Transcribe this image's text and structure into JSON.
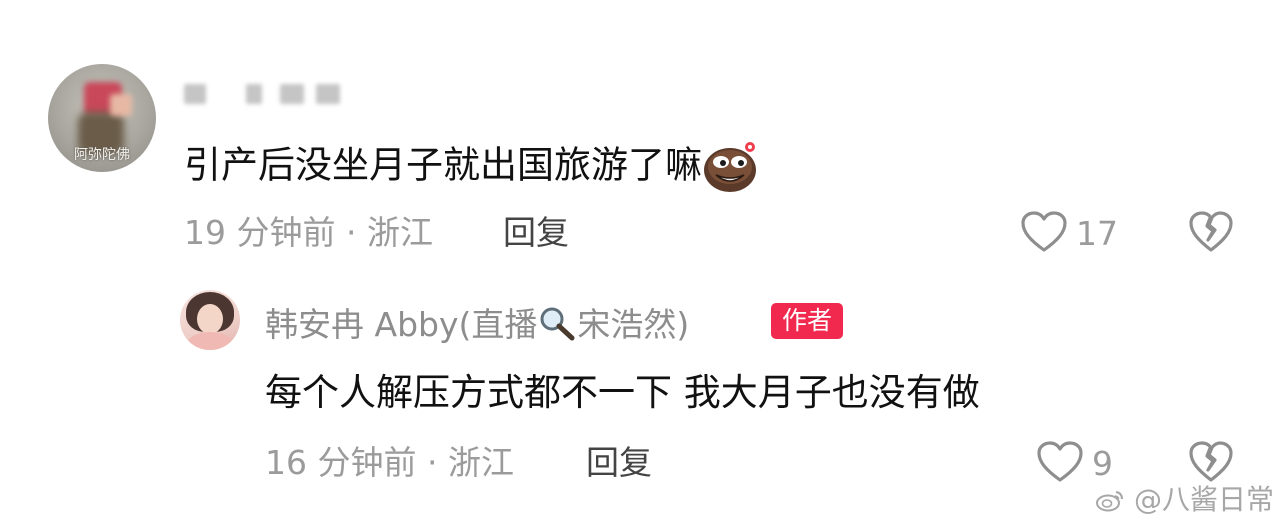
{
  "comment": {
    "avatar_caption": "阿弥陀佛",
    "text": "引产后没坐月子就出国旅游了嘛",
    "emoji": "sly-face-emoji",
    "time": "19 分钟前",
    "location": "浙江",
    "separator": "·",
    "reply_label": "回复",
    "like_count": "17"
  },
  "reply": {
    "author_name": "韩安冉 Abby(直播",
    "author_name_suffix": "宋浩然)",
    "search_icon": "magnifier-icon",
    "badge": "作者",
    "text": "每个人解压方式都不一下 我大月子也没有做",
    "time": "16 分钟前",
    "location": "浙江",
    "separator": "·",
    "reply_label": "回复",
    "like_count": "9"
  },
  "watermark": {
    "text": "@八酱日常"
  },
  "colors": {
    "text": "#111111",
    "meta": "#9b9b9b",
    "badge": "#f1294f"
  }
}
